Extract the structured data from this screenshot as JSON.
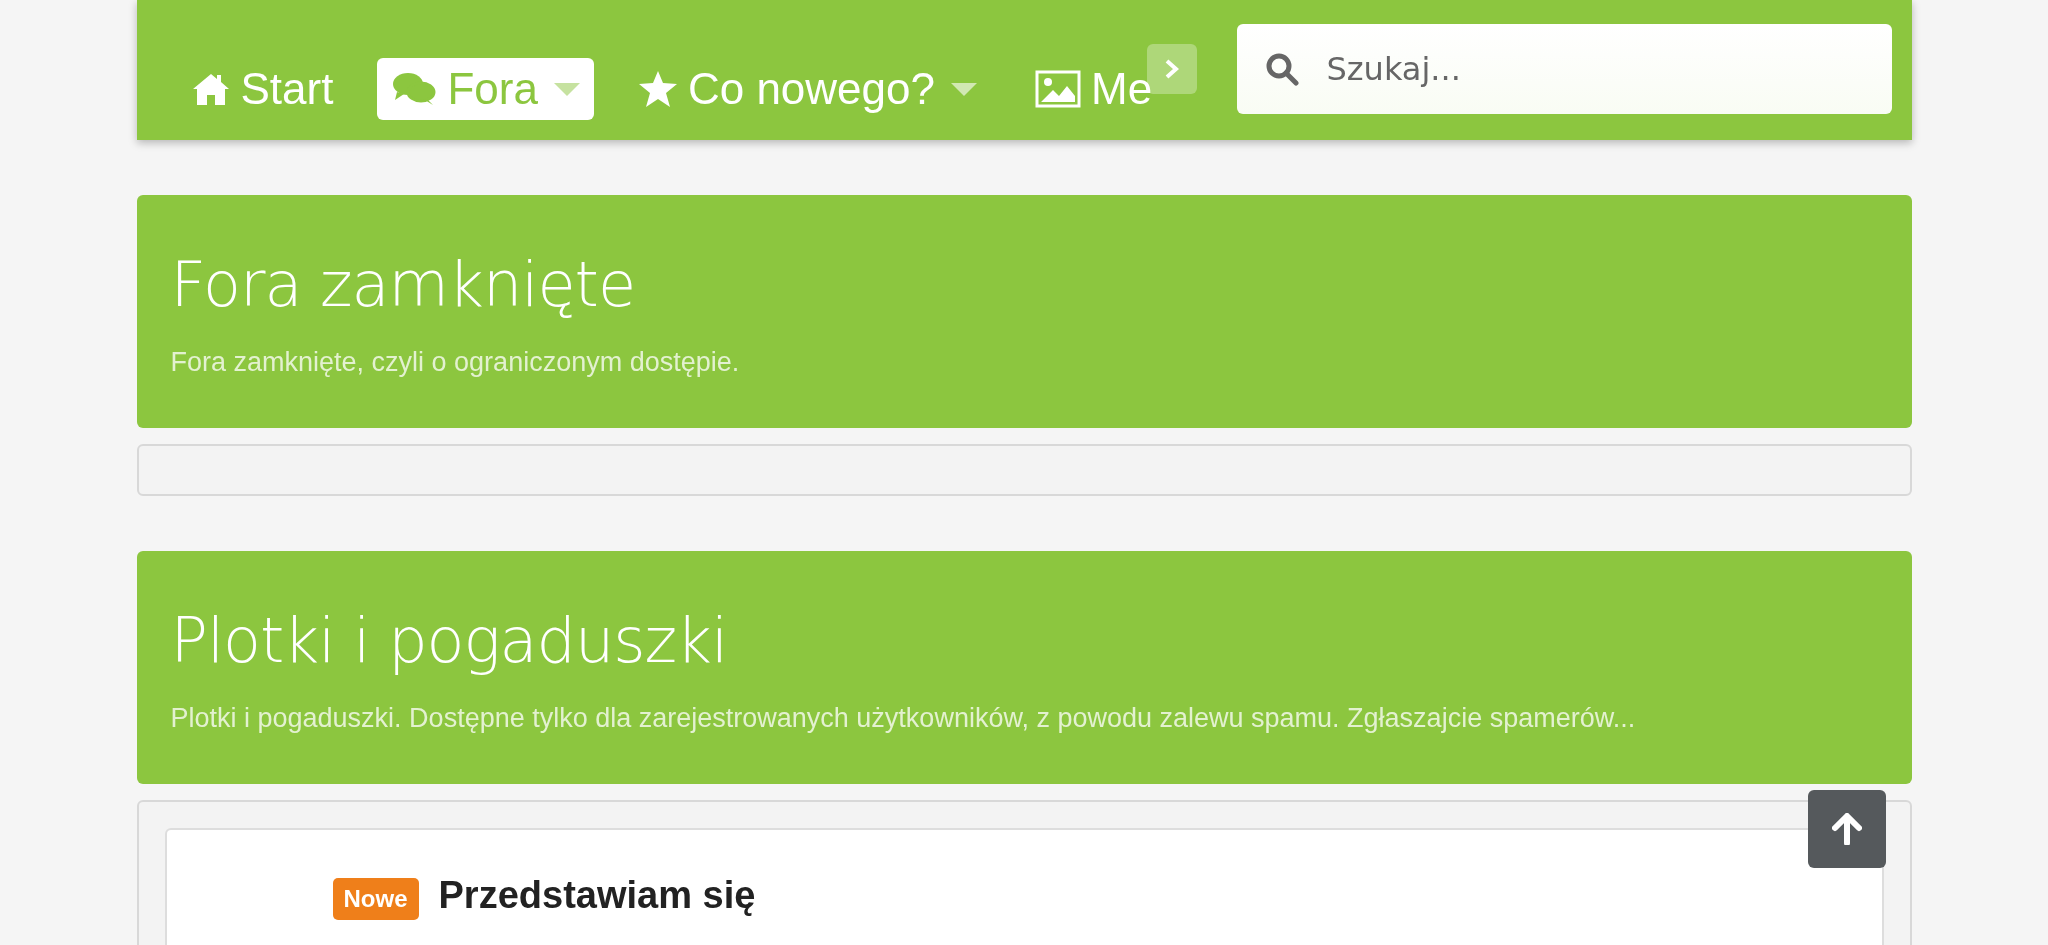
{
  "nav": {
    "tabs": [
      {
        "label": "Start",
        "kind": "home",
        "selected": false,
        "dropdown": false
      },
      {
        "label": "Fora",
        "kind": "chat",
        "selected": true,
        "dropdown": true
      },
      {
        "label": "Co nowego?",
        "kind": "star",
        "selected": false,
        "dropdown": true
      },
      {
        "label": "Me",
        "kind": "image",
        "selected": false,
        "dropdown": false
      }
    ],
    "search": {
      "placeholder": "Szukaj..."
    }
  },
  "categories": [
    {
      "title": "Fora zamknięte",
      "description": "Fora zamknięte, czyli o ograniczonym dostępie."
    },
    {
      "title": "Plotki i pogaduszki",
      "description": "Plotki i pogaduszki. Dostępne tylko dla zarejestrowanych użytkowników, z powodu zalewu spamu. Zgłaszajcie spamerów...",
      "threads": [
        {
          "badge": "Nowe",
          "title": "Przedstawiam się"
        }
      ]
    }
  ]
}
